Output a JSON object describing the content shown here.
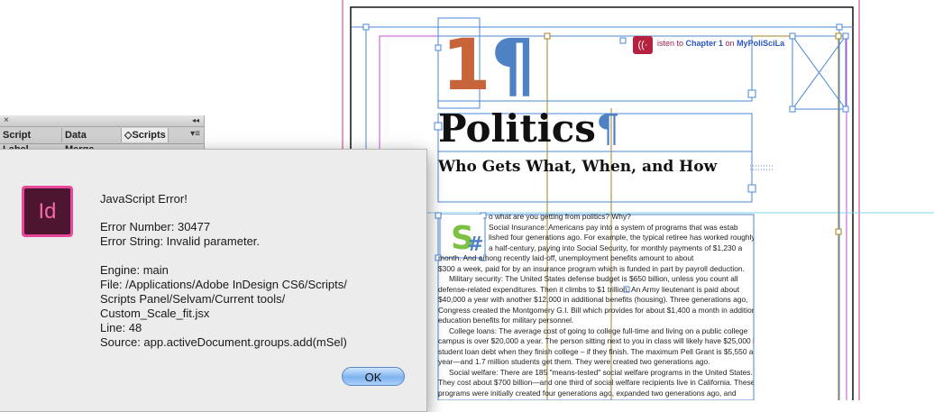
{
  "panel": {
    "tabs": [
      "Script Label",
      "Data Merge",
      "Scripts"
    ],
    "active_tab_prefix": "◇"
  },
  "dialog": {
    "app_icon_label": "Id",
    "heading": "JavaScript Error!",
    "error_number": "Error Number: 30477",
    "error_string": "Error String: Invalid parameter.",
    "engine": "Engine: main",
    "file_line1": "File: /Applications/Adobe InDesign CS6/Scripts/",
    "file_line2": "Scripts Panel/Selvam/Current tools/",
    "file_line3": "Custom_Scale_fit.jsx",
    "line": "Line: 48",
    "source": "Source: app.activeDocument.groups.add(mSel)",
    "ok_label": "OK"
  },
  "document": {
    "chapter_number": "1",
    "pilcrow": "¶",
    "listen_prefix": "isten to ",
    "listen_link1": "Chapter 1",
    "listen_mid": " on ",
    "listen_link2": "MyPoliSciLa",
    "title": "Politics",
    "subtitle": "Who Gets What, When, and How",
    "body": [
      "o what are you getting from politics? Why?",
      "Social Insurance: Americans pay into a system of programs that was estab",
      "lished four generations ago. For example, the typical retiree has worked roughly",
      "a half-century, paying into Social Security, for monthly payments of $1,230 a",
      "month. And among recently laid-off, unemployment benefits amount to about",
      "$300 a week, paid for by an insurance program which is funded in part by payroll deduction.",
      "Military security: The United States defense budget is $650 billion, unless you count all",
      "defense-related expenditures. Then it climbs to $1 trillion. An Army lieutenant is paid about",
      "$40,000 a year with another $12,000 in additional benefits (housing). Three generations ago,",
      "Congress created the Montgomery G.I. Bill which provides for about $1,400 a month in additional",
      "education benefits for military personnel.",
      "College loans: The average cost of going to college full-time and living on a public college",
      "campus is over $20,000 a year. The person sitting next to you in class will likely have $25,000 in",
      "student loan debt when they finish college – if they finish. The maximum Pell Grant is $5,550 a",
      "year—and 1.7 million students get them. They were created two generations ago.",
      "Social welfare: There are 185 \"means-tested\" social welfare programs in the United States.",
      "They cost about $700 billion—and one third of social welfare recipients live in California. These",
      "programs were initially created four generations ago, expanded two generations ago, and"
    ]
  }
}
